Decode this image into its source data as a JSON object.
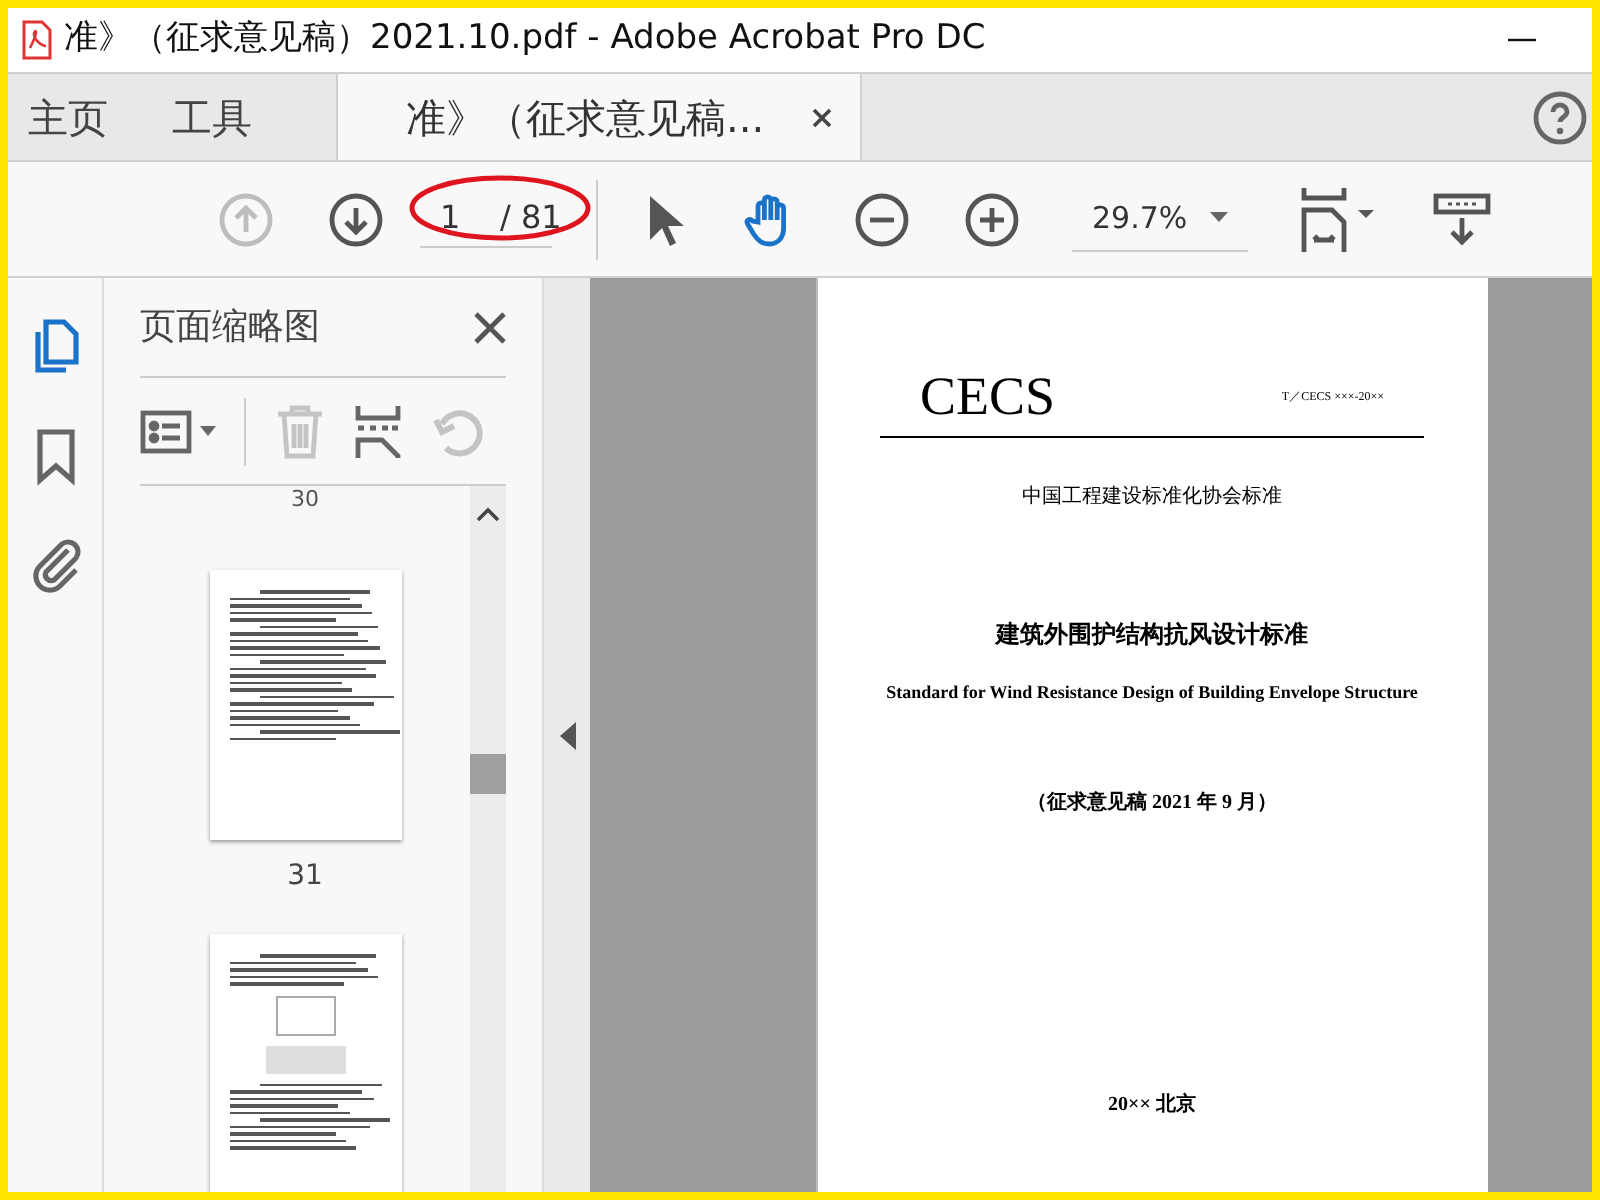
{
  "window": {
    "title": "准》（征求意见稿）2021.10.pdf - Adobe Acrobat Pro DC"
  },
  "tabs": [
    {
      "label": "主页",
      "selected": false,
      "closable": false
    },
    {
      "label": "工具",
      "selected": false,
      "closable": false
    },
    {
      "label": "准》（征求意见稿...",
      "selected": true,
      "closable": true
    }
  ],
  "toolbar": {
    "tools": [
      {
        "kind": "prev",
        "disabled": true,
        "selected": false
      },
      {
        "kind": "next",
        "disabled": false,
        "selected": false
      },
      {
        "kind": "page",
        "value": "1",
        "total": "/ 81"
      },
      {
        "kind": "select",
        "disabled": false,
        "selected": false
      },
      {
        "kind": "hand",
        "disabled": false,
        "selected": true
      },
      {
        "kind": "zoom_out",
        "disabled": false,
        "selected": false
      },
      {
        "kind": "zoom_in",
        "disabled": false,
        "selected": false
      },
      {
        "kind": "zoom",
        "value": "29.7%"
      },
      {
        "kind": "fit",
        "disabled": false,
        "selected": false
      },
      {
        "kind": "scroll",
        "disabled": false,
        "selected": false
      }
    ]
  },
  "rail": [
    {
      "kind": "pages",
      "selected": true
    },
    {
      "kind": "bookmarks",
      "selected": false
    },
    {
      "kind": "attachments",
      "selected": false
    }
  ],
  "thumbnail_panel": {
    "title": "页面缩略图",
    "tools": [
      {
        "kind": "options",
        "disabled": false
      },
      {
        "kind": "delete",
        "disabled": true
      },
      {
        "kind": "insert",
        "disabled": false
      },
      {
        "kind": "undo",
        "disabled": true
      }
    ],
    "thumbnails": [
      {
        "label": "30",
        "kind": "label_only"
      },
      {
        "label": "31",
        "kind": "page"
      },
      {
        "kind": "figure_page"
      }
    ]
  },
  "document": {
    "logo": "CECS",
    "code": "T／CECS ×××-20××",
    "issuer": "中国工程建设标准化协会标准",
    "title_cn": "建筑外围护结构抗风设计标准",
    "title_en": "Standard for Wind Resistance Design of Building Envelope Structure",
    "draft": "（征求意见稿  2021 年 9 月）",
    "footer": "20××  北京"
  }
}
